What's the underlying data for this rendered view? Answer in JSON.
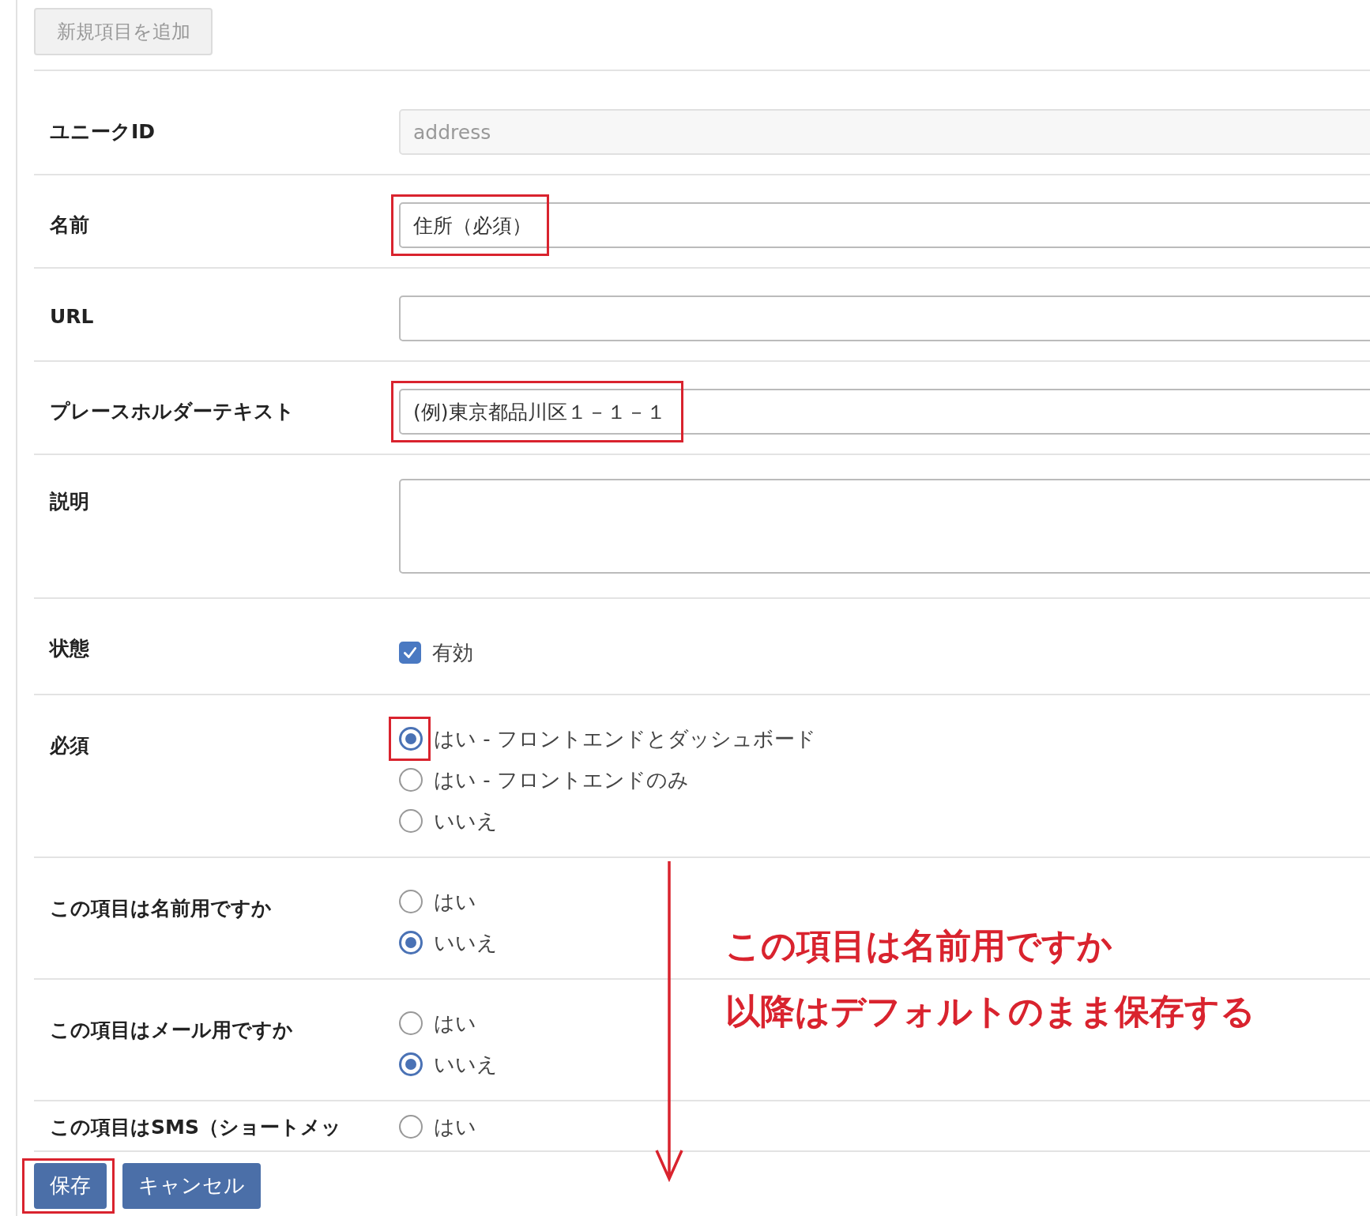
{
  "add_button": "新規項目を追加",
  "fields": [
    {
      "kind": "text",
      "label": "ユニークID",
      "value": "address",
      "disabled": true
    },
    {
      "kind": "text",
      "label": "名前",
      "value": "住所（必須）",
      "disabled": false,
      "highlighted": true
    },
    {
      "kind": "text",
      "label": "URL",
      "disabled": false
    },
    {
      "kind": "text",
      "label": "プレースホルダーテキスト",
      "value": "(例)東京都品川区１－１－１",
      "disabled": false,
      "highlighted": true
    },
    {
      "kind": "textarea",
      "label": "説明"
    },
    {
      "kind": "checkbox",
      "label": "状態",
      "option": "有効",
      "checked": true
    },
    {
      "kind": "radio",
      "label": "必須",
      "options": [
        {
          "label": "はい - フロントエンドとダッシュボード",
          "selected": true,
          "highlighted": true
        },
        {
          "label": "はい - フロントエンドのみ",
          "selected": false
        },
        {
          "label": "いいえ",
          "selected": false
        }
      ]
    },
    {
      "kind": "radio",
      "label": "この項目は名前用ですか",
      "options": [
        {
          "label": "はい",
          "selected": false
        },
        {
          "label": "いいえ",
          "selected": true
        }
      ]
    },
    {
      "kind": "radio",
      "label": "この項目はメール用ですか",
      "options": [
        {
          "label": "はい",
          "selected": false
        },
        {
          "label": "いいえ",
          "selected": true
        }
      ]
    },
    {
      "kind": "radio",
      "label": "この項目はSMS（ショートメッ",
      "options": [
        {
          "label": "はい",
          "selected": false
        }
      ]
    }
  ],
  "annotation": {
    "lines": [
      "この項目は名前用ですか",
      "以降はデフォルトのまま保存する"
    ]
  },
  "buttons": [
    {
      "label": "保存",
      "highlighted": true
    },
    {
      "label": "キャンセル"
    }
  ]
}
